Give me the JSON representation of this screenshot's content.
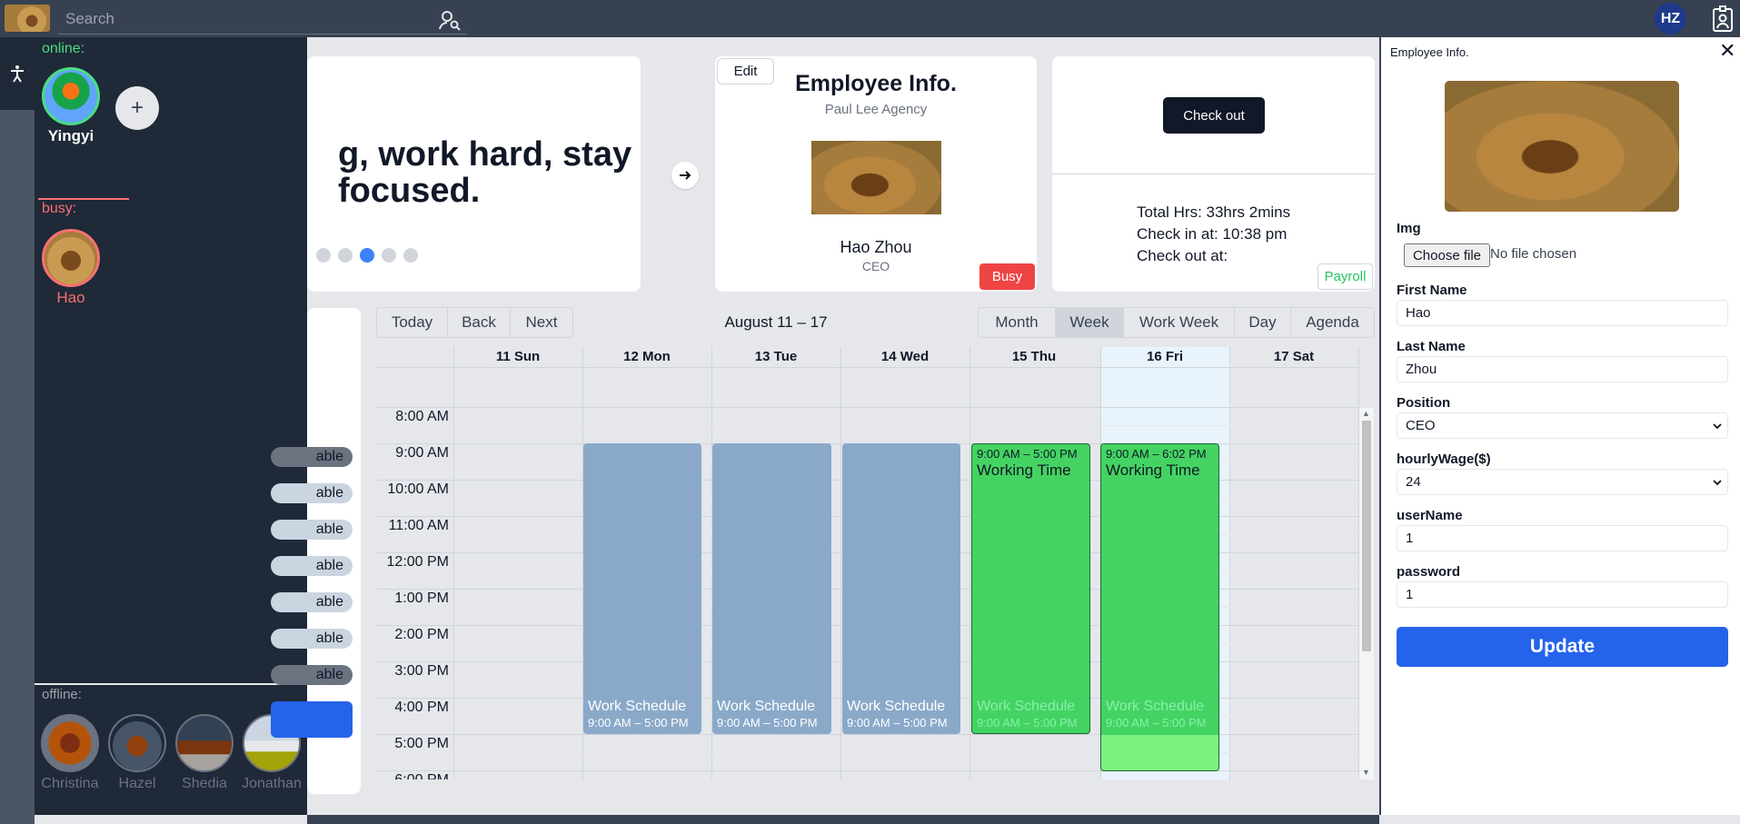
{
  "search": {
    "placeholder": "Search"
  },
  "user": {
    "initials": "HZ"
  },
  "people": {
    "online_label": "online:",
    "busy_label": "busy:",
    "offline_label": "offline:",
    "online": [
      {
        "name": "Yingyi"
      }
    ],
    "busy": [
      {
        "name": "Hao"
      }
    ],
    "offline": [
      {
        "name": "Christina"
      },
      {
        "name": "Hazel"
      },
      {
        "name": "Shedia"
      },
      {
        "name": "Jonathan"
      }
    ],
    "add_label": "+"
  },
  "quote": {
    "line1": "g, work hard, stay",
    "line2": "focused.",
    "active_dot": 3,
    "dot_count": 5
  },
  "employee_card": {
    "edit_label": "Edit",
    "title": "Employee Info.",
    "agency": "Paul Lee Agency",
    "name": "Hao Zhou",
    "role": "CEO",
    "status_label": "Busy"
  },
  "check_card": {
    "checkout_label": "Check out",
    "total": "Total Hrs: 33hrs 2mins",
    "check_in": "Check in at: 10:38 pm",
    "check_out": "Check out at:",
    "payroll_label": "Payroll"
  },
  "availability": {
    "pills": [
      "able",
      "able",
      "able",
      "able",
      "able",
      "able",
      "able"
    ]
  },
  "calendar": {
    "nav": {
      "today": "Today",
      "back": "Back",
      "next": "Next"
    },
    "range": "August 11 – 17",
    "views": [
      "Month",
      "Week",
      "Work Week",
      "Day",
      "Agenda"
    ],
    "active_view": "Week",
    "days": [
      "11 Sun",
      "12 Mon",
      "13 Tue",
      "14 Wed",
      "15 Thu",
      "16 Fri",
      "17 Sat"
    ],
    "today_index": 5,
    "times": [
      "8:00 AM",
      "9:00 AM",
      "10:00 AM",
      "11:00 AM",
      "12:00 PM",
      "1:00 PM",
      "2:00 PM",
      "3:00 PM",
      "4:00 PM",
      "5:00 PM",
      "6:00 PM"
    ],
    "events": [
      {
        "day": 1,
        "type": "schedule",
        "title": "Work Schedule",
        "time": "9:00 AM – 5:00 PM"
      },
      {
        "day": 2,
        "type": "schedule",
        "title": "Work Schedule",
        "time": "9:00 AM – 5:00 PM"
      },
      {
        "day": 3,
        "type": "schedule",
        "title": "Work Schedule",
        "time": "9:00 AM – 5:00 PM"
      },
      {
        "day": 4,
        "type": "working",
        "title": "Working Time",
        "time": "9:00 AM – 5:00 PM",
        "sub_title": "Work Schedule",
        "sub_time": "9:00 AM – 5:00 PM"
      },
      {
        "day": 5,
        "type": "working-over",
        "title": "Working Time",
        "time": "9:00 AM – 6:02 PM",
        "sub_title": "Work Schedule",
        "sub_time": "9:00 AM – 5:00 PM"
      }
    ]
  },
  "panel": {
    "title": "Employee Info.",
    "close": "✕",
    "img_label": "Img",
    "choose_file": "Choose file",
    "no_file": "No file chosen",
    "first_name_label": "First Name",
    "first_name": "Hao",
    "last_name_label": "Last Name",
    "last_name": "Zhou",
    "position_label": "Position",
    "position": "CEO",
    "wage_label": "hourlyWage($)",
    "wage": "24",
    "username_label": "userName",
    "username": "1",
    "password_label": "password",
    "password": "1",
    "update_label": "Update"
  },
  "colors": {
    "accent": "#2563eb",
    "online": "#4ade80",
    "busy": "#f87171",
    "schedule": "#8aa9c9",
    "working": "#44d362"
  }
}
